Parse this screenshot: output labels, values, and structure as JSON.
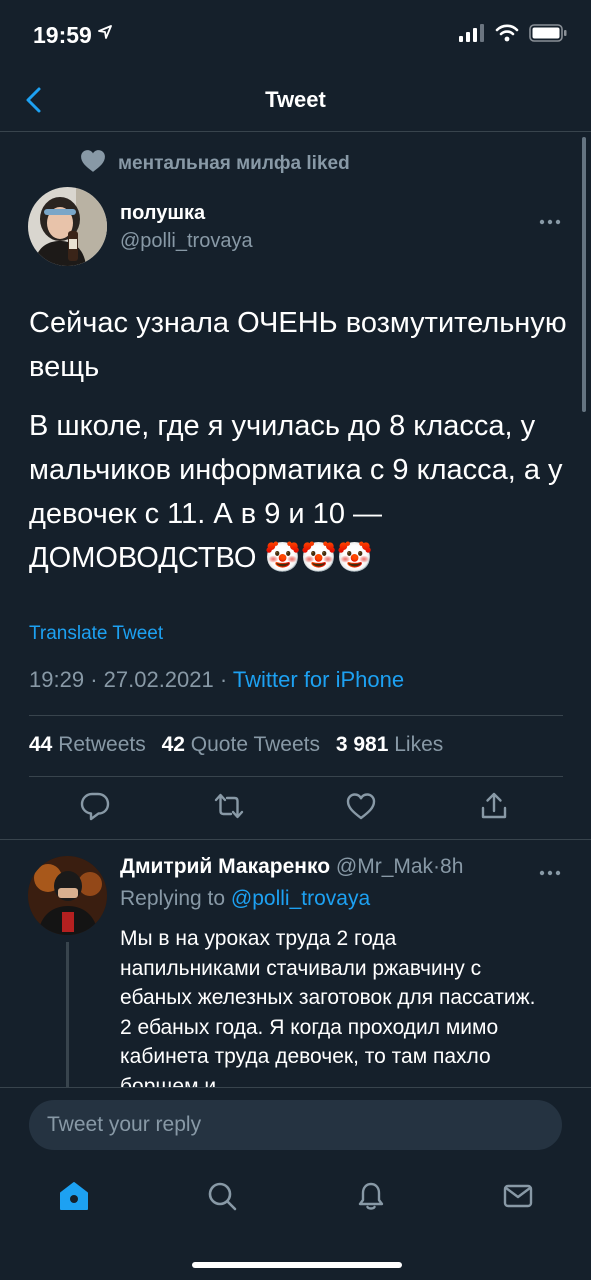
{
  "status_bar": {
    "time": "19:59"
  },
  "nav": {
    "title": "Tweet"
  },
  "social_context": {
    "text": "ментальная милфа liked"
  },
  "tweet": {
    "author_name": "полушка",
    "author_handle": "@polli_trovaya",
    "paragraphs": [
      "Сейчас узнала ОЧЕНЬ возмутительную вещь",
      "В школе, где я училась до 8 класса, у мальчиков информатика с 9 класса, а у девочек с 11. А в 9 и 10 — ДОМОВОДСТВО 🤡🤡🤡"
    ],
    "translate_label": "Translate Tweet",
    "time": "19:29",
    "date": "27.02.2021",
    "source": "Twitter for iPhone",
    "stats": {
      "retweets_count": "44",
      "retweets_label": "Retweets",
      "quotes_count": "42",
      "quotes_label": "Quote Tweets",
      "likes_count": "3 981",
      "likes_label": "Likes"
    }
  },
  "reply": {
    "name": "Дмитрий Макаренко",
    "handle": "@Mr_Mak",
    "time": "8h",
    "replying_prefix": "Replying to",
    "replying_to": "@polli_trovaya",
    "text": "Мы в на уроках труда 2 года напильниками стачивали ржавчину с ебаных железных заготовок для пассатиж. 2 ебаных года. Я когда проходил мимо кабинета труда девочек, то там пахло борщем и"
  },
  "compose": {
    "placeholder": "Tweet your reply"
  },
  "colors": {
    "background": "#15202b",
    "accent": "#1da1f2",
    "secondary_text": "#8899a6",
    "divider": "#38444d"
  },
  "icons": {
    "status": [
      "location-arrow-icon",
      "signal-icon",
      "wifi-icon",
      "battery-icon"
    ],
    "actions": [
      "reply-icon",
      "retweet-icon",
      "like-icon",
      "share-icon"
    ],
    "tabs": [
      "home-icon",
      "search-icon",
      "notifications-icon",
      "messages-icon"
    ]
  }
}
